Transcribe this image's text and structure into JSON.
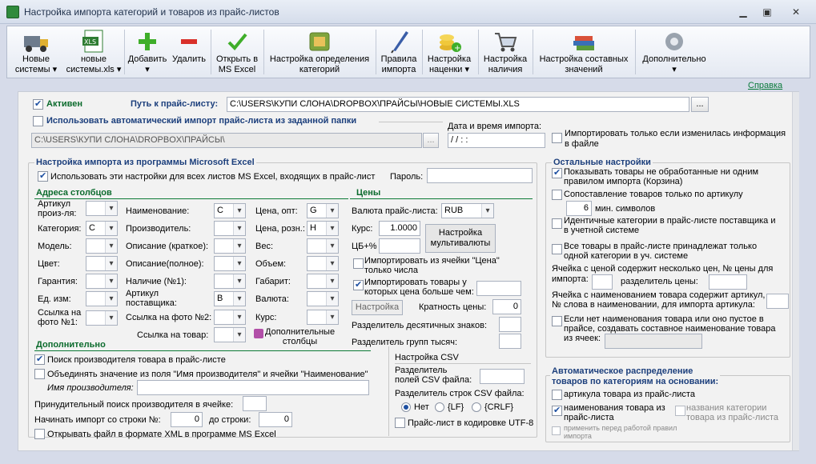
{
  "window": {
    "title": "Настройка импорта категорий и товаров из прайс-листов"
  },
  "toolbar": {
    "items": [
      {
        "label": "Новые\nсистемы ▾",
        "icon": "truck-icon"
      },
      {
        "label": "новые\nсистемы.xls ▾",
        "icon": "xls-file-icon"
      },
      {
        "label": "Добавить\n▾",
        "icon": "plus-icon"
      },
      {
        "label": "Удалить",
        "icon": "minus-icon"
      },
      {
        "label": "Открыть в\nMS Excel",
        "icon": "checkmark-icon"
      },
      {
        "label": "Настройка определения\nкатегорий",
        "icon": "category-icon"
      },
      {
        "label": "Правила\nимпорта",
        "icon": "quill-icon"
      },
      {
        "label": "Настройка\nнаценки ▾",
        "icon": "coins-icon"
      },
      {
        "label": "Настройка\nналичия",
        "icon": "cart-icon"
      },
      {
        "label": "Настройка составных\nзначений",
        "icon": "books-icon"
      },
      {
        "label": "Дополнительно\n▾",
        "icon": "gear-icon"
      }
    ]
  },
  "help": "Справка",
  "top": {
    "active_label": "Активен",
    "path_label": "Путь к прайс-листу:",
    "path_value": "C:\\USERS\\КУПИ СЛОНА\\DROPBOX\\ПРАЙСЫ\\НОВЫЕ СИСТЕМЫ.XLS",
    "browse": "...",
    "auto_import_label": "Использовать автоматический импорт прайс-листа из заданной папки",
    "folder_value": "C:\\USERS\\КУПИ СЛОНА\\DROPBOX\\ПРАЙСЫ\\",
    "datetime_label": "Дата и время импорта:",
    "datetime_value": " / /      :  :",
    "only_changed_label": "Импортировать только если изменилась информация\nв файле"
  },
  "excel": {
    "title": "Настройка импорта из программы Microsoft Excel",
    "use_all_label": "Использовать эти настройки для всех листов MS Excel, входящих в прайс-лист",
    "password_label": "Пароль:",
    "columns_title": "Адреса столбцов",
    "col1": [
      {
        "label": "Артикул\nпроиз-ля:",
        "value": ""
      },
      {
        "label": "Категория:",
        "value": "C"
      },
      {
        "label": "Модель:",
        "value": ""
      },
      {
        "label": "Цвет:",
        "value": ""
      },
      {
        "label": "Гарантия:",
        "value": ""
      },
      {
        "label": "Ед. изм:",
        "value": ""
      },
      {
        "label": "Ссылка на\nфото №1:",
        "value": ""
      }
    ],
    "col2": [
      {
        "label": "Наименование:",
        "value": "C"
      },
      {
        "label": "Производитель:",
        "value": ""
      },
      {
        "label": "Описание (краткое):",
        "value": ""
      },
      {
        "label": "Описание(полное):",
        "value": ""
      },
      {
        "label": "Наличие (№1):",
        "value": ""
      },
      {
        "label": "Артикул\nпоставщика:",
        "value": "B"
      },
      {
        "label": "Ссылка на фото №2:",
        "value": ""
      },
      {
        "label": "Ссылка на товар:",
        "value": ""
      }
    ],
    "col3": [
      {
        "label": "Цена, опт:",
        "value": "G"
      },
      {
        "label": "Цена, розн.:",
        "value": "H"
      },
      {
        "label": "Вес:",
        "value": ""
      },
      {
        "label": "Объем:",
        "value": ""
      },
      {
        "label": "Габарит:",
        "value": ""
      },
      {
        "label": "Валюта:",
        "value": ""
      },
      {
        "label": "Курс:",
        "value": ""
      }
    ],
    "extra_columns": "Дополнительные\nстолбцы"
  },
  "prices": {
    "title": "Цены",
    "currency_label": "Валюта прайс-листа:",
    "currency_value": "RUB",
    "rate_label": "Курс:",
    "rate_value": "1.0000",
    "cb_label": "ЦБ+%",
    "multi_btn": "Настройка\nмультивалюты",
    "import_price_cell": "Импортировать из ячейки \"Цена\"\nтолько числа",
    "price_greater": "Импортировать товары у\nкоторых цена больше чем:",
    "setup_btn": "Настройка",
    "multiplicity_label": "Кратность цены:",
    "multiplicity_value": "0",
    "decimal_sep_label": "Разделитель десятичных знаков:",
    "group_sep_label": "Разделитель групп тысяч:"
  },
  "additional": {
    "title": "Дополнительно",
    "search_maker": "Поиск производителя товара в прайс-листе",
    "merge": "Объединять значение из поля \"Имя производителя\" и ячейки \"Наименование\"",
    "maker_name_label": "Имя производителя:",
    "forced_search_label": "Принудительный поиск производителя в ячейке:",
    "start_row_label": "Начинать импорт со строки №:",
    "start_row_value": "0",
    "to_row_label": "до строки:",
    "to_row_value": "0",
    "open_xml": "Открывать файл в формате XML в программе MS Excel"
  },
  "csv": {
    "title": "Настройка CSV",
    "field_sep_label": "Разделитель\nполей CSV файла:",
    "row_sep_label": "Разделитель строк CSV файла:",
    "radios": [
      "Нет",
      "{LF}",
      "{CRLF}"
    ],
    "utf8_label": "Прайс-лист в кодировке UTF-8"
  },
  "other": {
    "title": "Остальные настройки",
    "show_unprocessed": "Показывать товары не обработанные ни одним\nправилом импорта (Корзина)",
    "match_article": "Сопоставление товаров только по артикулу",
    "min_symbols_value": "6",
    "min_symbols_label": "мин. символов",
    "identical_categories": "Идентичные категории в прайс-листе поставщика и\nв учетной системе",
    "all_one_category": "Все товары в прайс-листе принадлежат только\nодной категории в уч. системе",
    "multi_price_label": "Ячейка с ценой содержит несколько цен, № цены для\nимпорта:",
    "price_sep_label": "разделитель цены:",
    "article_in_name_label": "Ячейка с наименованием товара содержит артикул,\n№ слова в наименовании, для импорта артикула:",
    "composite_name_label": "Если нет наименования товара или оно пустое в\nпрайсе, создавать составное наименование товара\nиз ячеек:"
  },
  "auto_dist": {
    "title": "Автоматическое распределение\nтоваров по категориям на основании:",
    "by_article": "артикула товара из прайс-листа",
    "by_name": "наименования товара из\nпрайс-листа",
    "by_category_names": "названия  категории\nтовара из прайс-листа",
    "apply_before": "применить перед работой правил\nимпорта"
  },
  "colors": {
    "accent": "#0c6b2d",
    "heading_blue": "#1c3f7c",
    "panel": "#f2f2f2"
  }
}
